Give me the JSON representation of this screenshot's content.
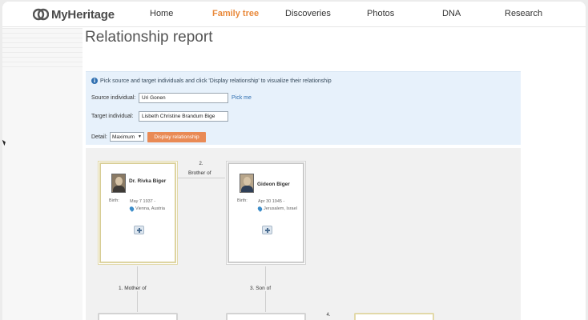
{
  "header": {
    "brand": "MyHeritage",
    "nav": [
      {
        "label": "Home",
        "active": false
      },
      {
        "label": "Family tree",
        "active": true
      },
      {
        "label": "Discoveries",
        "active": false
      },
      {
        "label": "Photos",
        "active": false
      },
      {
        "label": "DNA",
        "active": false
      },
      {
        "label": "Research",
        "active": false
      }
    ],
    "accent_color": "#e98a3c"
  },
  "page_title": "Relationship report",
  "form": {
    "info_text": "Pick source and target individuals and click 'Display relationship' to visualize their relationship",
    "source_label": "Source individual:",
    "source_value": "Uri Gonen",
    "pick_me": "Pick me",
    "target_label": "Target individual:",
    "target_value": "Lisbeth Christine Brandum Bige",
    "detail_label": "Detail:",
    "detail_value": "Maximum",
    "display_button": "Display relationship",
    "button_color": "#e98a55"
  },
  "tree": {
    "people": [
      {
        "name": "Dr. Rivka Biger",
        "birth_label": "Birth:",
        "birth_date": "May 7 1937 -",
        "birth_place": "Vienna, Austria"
      },
      {
        "name": "Gideon Biger",
        "birth_label": "Birth:",
        "birth_date": "Apr 30 1945 -",
        "birth_place": "Jerusalem, Israel"
      }
    ],
    "relations": [
      {
        "num": "2.",
        "label": "Brother of"
      },
      {
        "label": "1.  Mother of"
      },
      {
        "label": "3.  Son of"
      },
      {
        "num": "4."
      }
    ]
  }
}
